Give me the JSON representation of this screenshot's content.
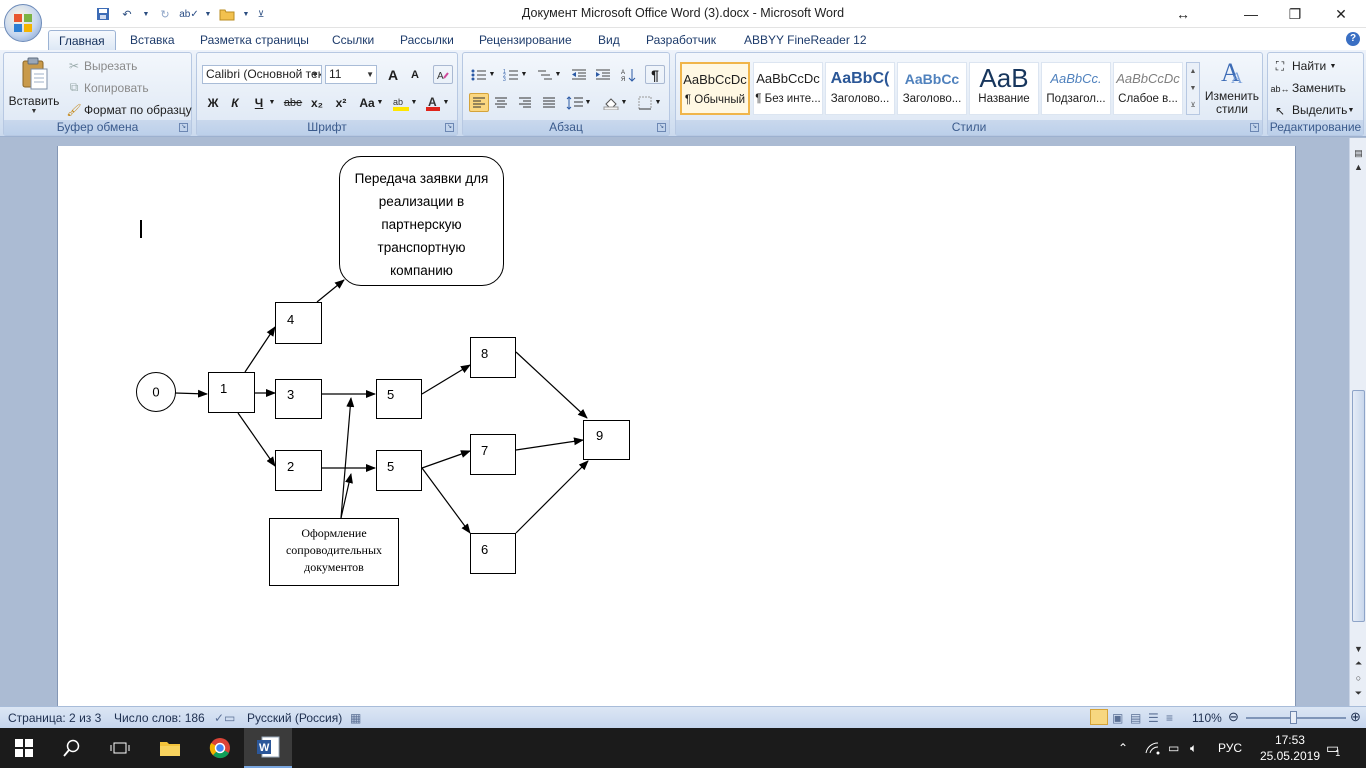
{
  "window": {
    "title": "Документ Microsoft Office Word (3).docx - Microsoft Word",
    "resize_glyph": "↔",
    "minimize": "—",
    "maximize": "❐",
    "close": "✕"
  },
  "ribbon_tabs": [
    "Главная",
    "Вставка",
    "Разметка страницы",
    "Ссылки",
    "Рассылки",
    "Рецензирование",
    "Вид",
    "Разработчик",
    "ABBYY FineReader 12"
  ],
  "clipboard": {
    "label": "Буфер обмена",
    "paste": "Вставить",
    "cut": "Вырезать",
    "copy": "Копировать",
    "format_painter": "Формат по образцу"
  },
  "font": {
    "label": "Шрифт",
    "name": "Calibri (Основной текст)",
    "size": "11",
    "bold": "Ж",
    "italic": "К",
    "underline": "Ч",
    "strike": "abe",
    "subscript": "x₂",
    "superscript": "x²",
    "change_case": "Aa",
    "grow": "A",
    "shrink": "A"
  },
  "paragraph": {
    "label": "Абзац",
    "pilcrow": "¶"
  },
  "styles": {
    "label": "Стили",
    "items": [
      {
        "sample": "AaBbCcDc",
        "name": "¶ Обычный"
      },
      {
        "sample": "AaBbCcDc",
        "name": "¶ Без инте..."
      },
      {
        "sample": "AaBbC(",
        "name": "Заголово..."
      },
      {
        "sample": "AaBbCc",
        "name": "Заголово..."
      },
      {
        "sample": "AaB",
        "name": "Название"
      },
      {
        "sample": "AaBbCc.",
        "name": "Подзагол..."
      },
      {
        "sample": "AaBbCcDc",
        "name": "Слабое в..."
      }
    ],
    "change_styles_line1": "Изменить",
    "change_styles_line2": "стили"
  },
  "editing": {
    "label": "Редактирование",
    "find": "Найти",
    "replace": "Заменить",
    "select": "Выделить"
  },
  "diagram": {
    "nodes": {
      "n0": "0",
      "n1": "1",
      "n2": "2",
      "n3": "3",
      "n4": "4",
      "n5a": "5",
      "n5b": "5",
      "n6": "6",
      "n7": "7",
      "n8": "8",
      "n9": "9"
    },
    "transfer_box": "Передача заявки для реализации в партнерскую транспортную компанию",
    "docs_box": "Оформление сопроводительных документов"
  },
  "status": {
    "page": "Страница: 2 из 3",
    "words": "Число слов: 186",
    "language": "Русский (Россия)",
    "zoom": "110%"
  },
  "taskbar": {
    "lang": "РУС",
    "time": "17:53",
    "date": "25.05.2019",
    "notifications": "1"
  }
}
